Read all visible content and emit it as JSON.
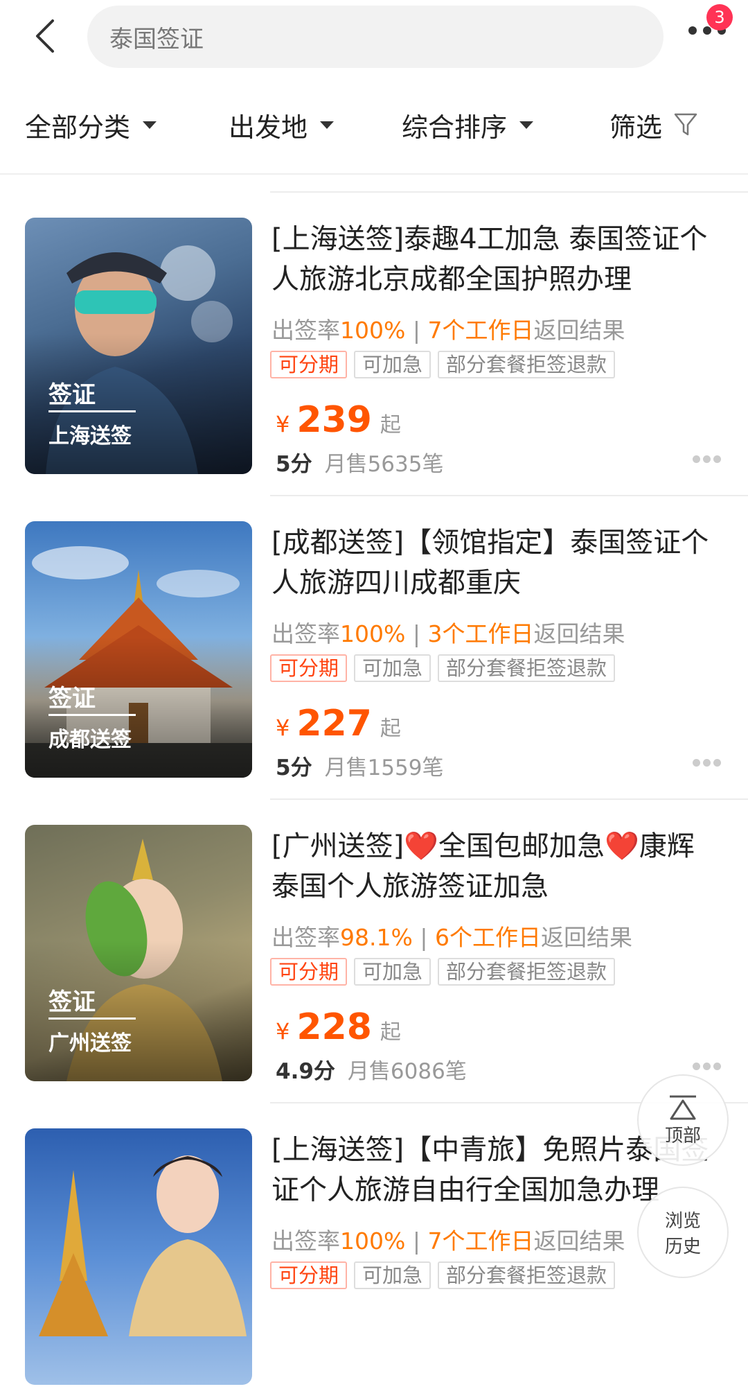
{
  "search": {
    "query": "泰国签证"
  },
  "header": {
    "badge_count": "3"
  },
  "filters": [
    {
      "label": "全部分类"
    },
    {
      "label": "出发地"
    },
    {
      "label": "综合排序"
    },
    {
      "label": "筛选"
    }
  ],
  "products": [
    {
      "title": "[上海送签]泰趣4工加急 泰国签证个人旅游北京成都全国护照办理",
      "rate_label": "出签率",
      "rate_value": "100%",
      "days": "7个工作日",
      "result_label": "返回结果",
      "tags": [
        "可分期",
        "可加急",
        "部分套餐拒签退款"
      ],
      "image_tag": "签证",
      "image_sub": "上海送签",
      "currency": "¥",
      "price": "239",
      "price_suffix": "起",
      "score": "5分",
      "sales": "月售5635笔"
    },
    {
      "title": "[成都送签]【领馆指定】泰国签证个人旅游四川成都重庆",
      "rate_label": "出签率",
      "rate_value": "100%",
      "days": "3个工作日",
      "result_label": "返回结果",
      "tags": [
        "可分期",
        "可加急",
        "部分套餐拒签退款"
      ],
      "image_tag": "签证",
      "image_sub": "成都送签",
      "currency": "¥",
      "price": "227",
      "price_suffix": "起",
      "score": "5分",
      "sales": "月售1559笔"
    },
    {
      "title": "[广州送签]❤️全国包邮加急❤️康辉泰国个人旅游签证加急",
      "rate_label": "出签率",
      "rate_value": "98.1%",
      "days": "6个工作日",
      "result_label": "返回结果",
      "tags": [
        "可分期",
        "可加急",
        "部分套餐拒签退款"
      ],
      "image_tag": "签证",
      "image_sub": "广州送签",
      "currency": "¥",
      "price": "228",
      "price_suffix": "起",
      "score": "4.9分",
      "sales": "月售6086笔"
    },
    {
      "title": "[上海送签]【中青旅】免照片泰国签证个人旅游自由行全国加急办理",
      "rate_label": "出签率",
      "rate_value": "100%",
      "days": "7个工作日",
      "result_label": "返回结果",
      "tags": [
        "可分期",
        "可加急",
        "部分套餐拒签退款"
      ]
    }
  ],
  "floating": {
    "top_label": "顶部",
    "history_line1": "浏览",
    "history_line2": "历史"
  },
  "colors": {
    "accent": "#ff5500",
    "highlight": "#ff7a00",
    "badge": "#ff3355"
  }
}
